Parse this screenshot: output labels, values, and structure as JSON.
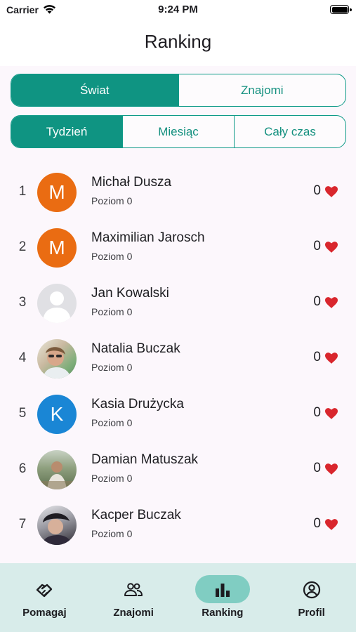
{
  "status_bar": {
    "carrier": "Carrier",
    "time": "9:24 PM"
  },
  "header": {
    "title": "Ranking"
  },
  "scope_tabs": [
    {
      "label": "Świat",
      "active": true
    },
    {
      "label": "Znajomi",
      "active": false
    }
  ],
  "period_tabs": [
    {
      "label": "Tydzień",
      "active": true
    },
    {
      "label": "Miesiąc",
      "active": false
    },
    {
      "label": "Cały czas",
      "active": false
    }
  ],
  "ranking": [
    {
      "rank": "1",
      "name": "Michał Dusza",
      "level": "Poziom 0",
      "score": "0",
      "avatar": {
        "type": "initial",
        "letter": "M",
        "color": "#ea6c12"
      }
    },
    {
      "rank": "2",
      "name": "Maximilian Jarosch",
      "level": "Poziom 0",
      "score": "0",
      "avatar": {
        "type": "initial",
        "letter": "M",
        "color": "#ea6c12"
      }
    },
    {
      "rank": "3",
      "name": "Jan Kowalski",
      "level": "Poziom 0",
      "score": "0",
      "avatar": {
        "type": "placeholder-icon"
      }
    },
    {
      "rank": "4",
      "name": "Natalia Buczak",
      "level": "Poziom 0",
      "score": "0",
      "avatar": {
        "type": "photo"
      }
    },
    {
      "rank": "5",
      "name": "Kasia Drużycka",
      "level": "Poziom 0",
      "score": "0",
      "avatar": {
        "type": "initial",
        "letter": "K",
        "color": "#1a86d5"
      }
    },
    {
      "rank": "6",
      "name": "Damian Matuszak",
      "level": "Poziom 0",
      "score": "0",
      "avatar": {
        "type": "photo"
      }
    },
    {
      "rank": "7",
      "name": "Kacper Buczak",
      "level": "Poziom 0",
      "score": "0",
      "avatar": {
        "type": "photo"
      }
    }
  ],
  "score_icon": "heart-icon",
  "bottom_nav": [
    {
      "label": "Pomagaj",
      "icon": "handshake-icon",
      "active": false
    },
    {
      "label": "Znajomi",
      "icon": "people-icon",
      "active": false
    },
    {
      "label": "Ranking",
      "icon": "bar-chart-icon",
      "active": true
    },
    {
      "label": "Profil",
      "icon": "account-circle-icon",
      "active": false
    }
  ],
  "colors": {
    "accent": "#0f9482",
    "heart": "#d9262d",
    "nav_bg": "#d8ecea",
    "nav_active": "#80cdc2",
    "content_bg": "#fcf7fc"
  }
}
